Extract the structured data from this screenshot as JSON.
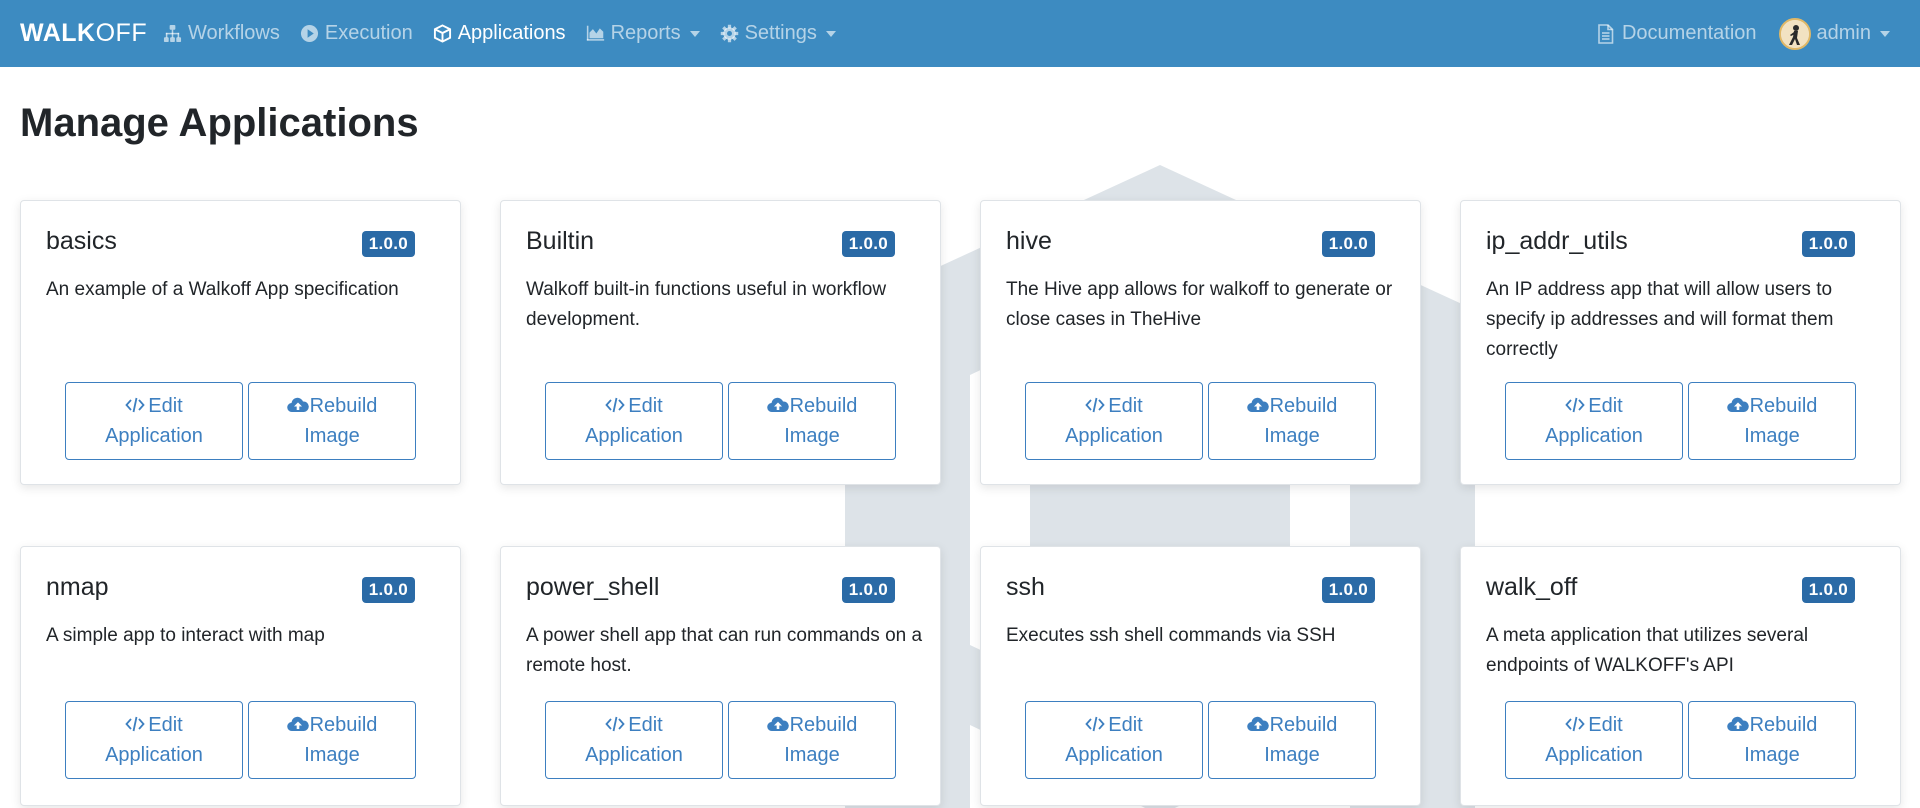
{
  "nav": {
    "brand_bold": "WALK",
    "brand_thin": "OFF",
    "items": [
      {
        "label": "Workflows",
        "icon": "sitemap-icon"
      },
      {
        "label": "Execution",
        "icon": "play-circle-icon"
      },
      {
        "label": "Applications",
        "icon": "cube-icon"
      },
      {
        "label": "Reports",
        "icon": "area-chart-icon"
      },
      {
        "label": "Settings",
        "icon": "gear-icon"
      }
    ],
    "documentation": "Documentation",
    "user": "admin"
  },
  "page": {
    "title": "Manage Applications"
  },
  "buttons": {
    "edit_line1": "Edit",
    "edit_line2": "Application",
    "rebuild_line1": "Rebuild",
    "rebuild_line2": "Image"
  },
  "apps": [
    {
      "name": "basics",
      "version": "1.0.0",
      "description": "An example of a Walkoff App specification"
    },
    {
      "name": "Builtin",
      "version": "1.0.0",
      "description": "Walkoff built-in functions useful in workflow development."
    },
    {
      "name": "hive",
      "version": "1.0.0",
      "description": "The Hive app allows for walkoff to generate or close cases in TheHive"
    },
    {
      "name": "ip_addr_utils",
      "version": "1.0.0",
      "description": "An IP address app that will allow users to specify ip addresses and will format them correctly"
    },
    {
      "name": "nmap",
      "version": "1.0.0",
      "description": "A simple app to interact with map"
    },
    {
      "name": "power_shell",
      "version": "1.0.0",
      "description": "A power shell app that can run commands on a remote host."
    },
    {
      "name": "ssh",
      "version": "1.0.0",
      "description": "Executes ssh shell commands via SSH"
    },
    {
      "name": "walk_off",
      "version": "1.0.0",
      "description": "A meta application that utilizes several endpoints of WALKOFF's API"
    }
  ],
  "colors": {
    "navbar": "#3d8bc1",
    "badge": "#2a6aa6",
    "button": "#3d7fc0"
  }
}
